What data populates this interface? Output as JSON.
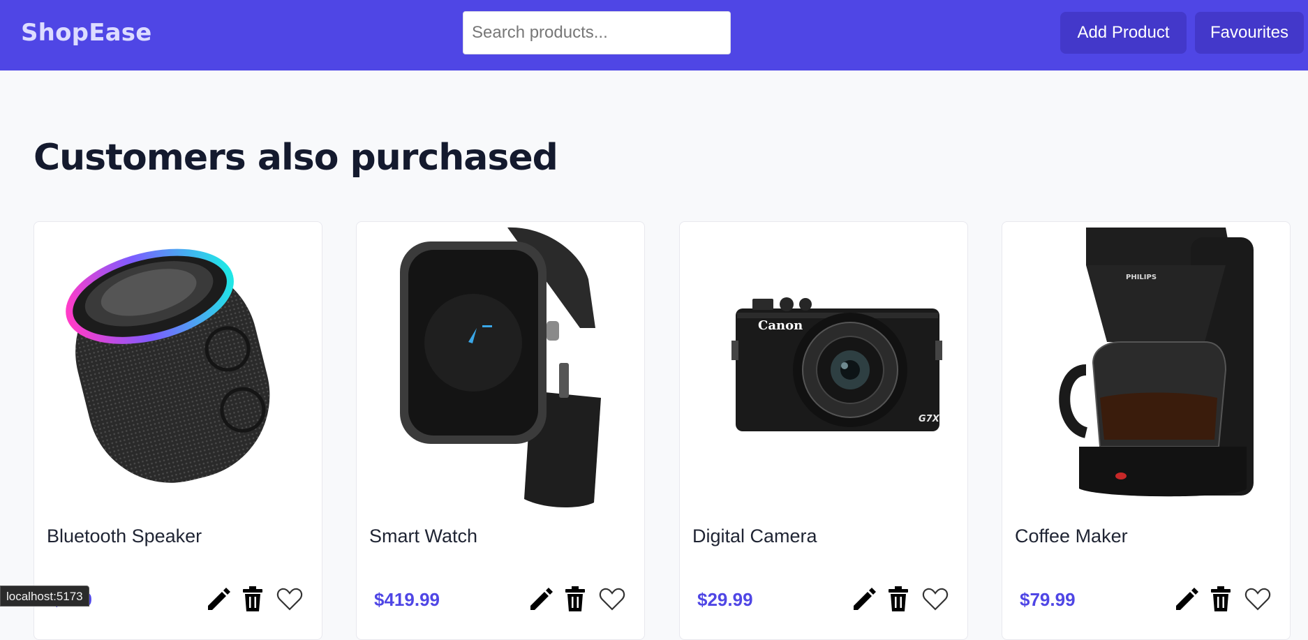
{
  "navbar": {
    "brand": "ShopEase",
    "search_placeholder": "Search products...",
    "add_product_label": "Add Product",
    "favourites_label": "Favourites",
    "accent_color": "#4f46e5"
  },
  "section": {
    "title": "Customers also purchased"
  },
  "products": [
    {
      "name": "Bluetooth Speaker",
      "price": "$..99",
      "image_icon": "bluetooth-speaker-image"
    },
    {
      "name": "Smart Watch",
      "price": "$419.99",
      "image_icon": "smart-watch-image"
    },
    {
      "name": "Digital Camera",
      "price": "$29.99",
      "image_icon": "digital-camera-image"
    },
    {
      "name": "Coffee Maker",
      "price": "$79.99",
      "image_icon": "coffee-maker-image"
    }
  ],
  "camera_brand": "Canon",
  "camera_model": "G7X",
  "coffee_brand": "PHILIPS",
  "status_bar": {
    "url": "localhost:5173"
  }
}
